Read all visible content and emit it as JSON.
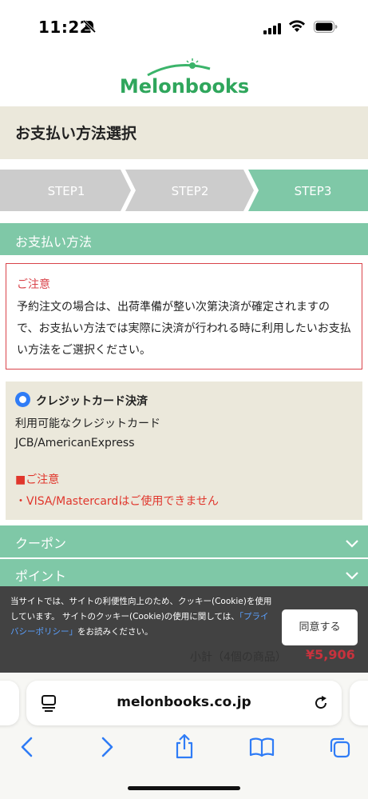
{
  "status_bar": {
    "time": "11:22"
  },
  "header": {
    "title": "お支払い方法選択"
  },
  "steps": [
    {
      "label": "STEP1",
      "active": false
    },
    {
      "label": "STEP2",
      "active": false
    },
    {
      "label": "STEP3",
      "active": true
    }
  ],
  "payment_section": {
    "title": "お支払い方法"
  },
  "notice": {
    "title": "ご注意",
    "text": "予約注文の場合は、出荷準備が整い次第決済が確定されますので、お支払い方法では実際に決済が行われる時に利用したいお支払い方法をご選択ください。"
  },
  "credit_card": {
    "title": "クレジットカード決済",
    "line1": "利用可能なクレジットカード",
    "line2": "JCB/AmericanExpress",
    "warn_title": "■ご注意",
    "warn_text": "・VISA/Mastercardはご使用できません"
  },
  "coupon": {
    "label": "クーポン"
  },
  "point": {
    "label": "ポイント"
  },
  "cookie": {
    "text_before": "当サイトでは、サイトの利便性向上のため、クッキー(Cookie)を使用しています。 サイトのクッキー(Cookie)の使用に関しては、",
    "link": "「プライバシーポリシー」",
    "text_after": "をお読みください。",
    "agree_label": "同意する"
  },
  "order": {
    "subtotal_label": "小計（4個の商品）",
    "subtotal_value": "¥5,906"
  },
  "browser": {
    "url": "melonbooks.co.jp"
  },
  "colors": {
    "accent_green": "#7fc8a7",
    "notice_red": "#d9434a",
    "price_red": "#c8323d"
  }
}
